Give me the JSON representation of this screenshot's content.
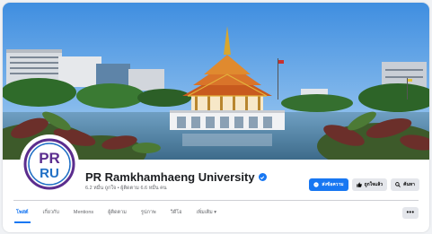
{
  "profile": {
    "name": "PR Ramkhamhaeng University",
    "stats": "6.2 หมื่น ถูกใจ • ผู้ติดตาม 6.6 หมื่น คน",
    "logo_text_top": "PR",
    "logo_text_bottom": "RU",
    "verified": true
  },
  "actions": {
    "message_label": "ส่งข้อความ",
    "like_label": "ถูกใจแล้ว",
    "search_label": "ค้นหา"
  },
  "tabs": [
    {
      "label": "โพสต์",
      "active": true
    },
    {
      "label": "เกี่ยวกับ",
      "active": false
    },
    {
      "label": "Mentions",
      "active": false
    },
    {
      "label": "ผู้ติดตาม",
      "active": false
    },
    {
      "label": "รูปภาพ",
      "active": false
    },
    {
      "label": "วิดีโอ",
      "active": false
    },
    {
      "label": "เพิ่มเติม ▾",
      "active": false
    }
  ],
  "more_label": "•••",
  "colors": {
    "accent": "#1877f2",
    "logo_purple": "#5b2d8e",
    "logo_blue": "#1f6fc5"
  },
  "icons": {
    "message": "messenger-icon",
    "like": "thumbs-up-icon",
    "search": "search-icon",
    "verified": "verified-badge-icon",
    "more": "more-dots-icon"
  }
}
